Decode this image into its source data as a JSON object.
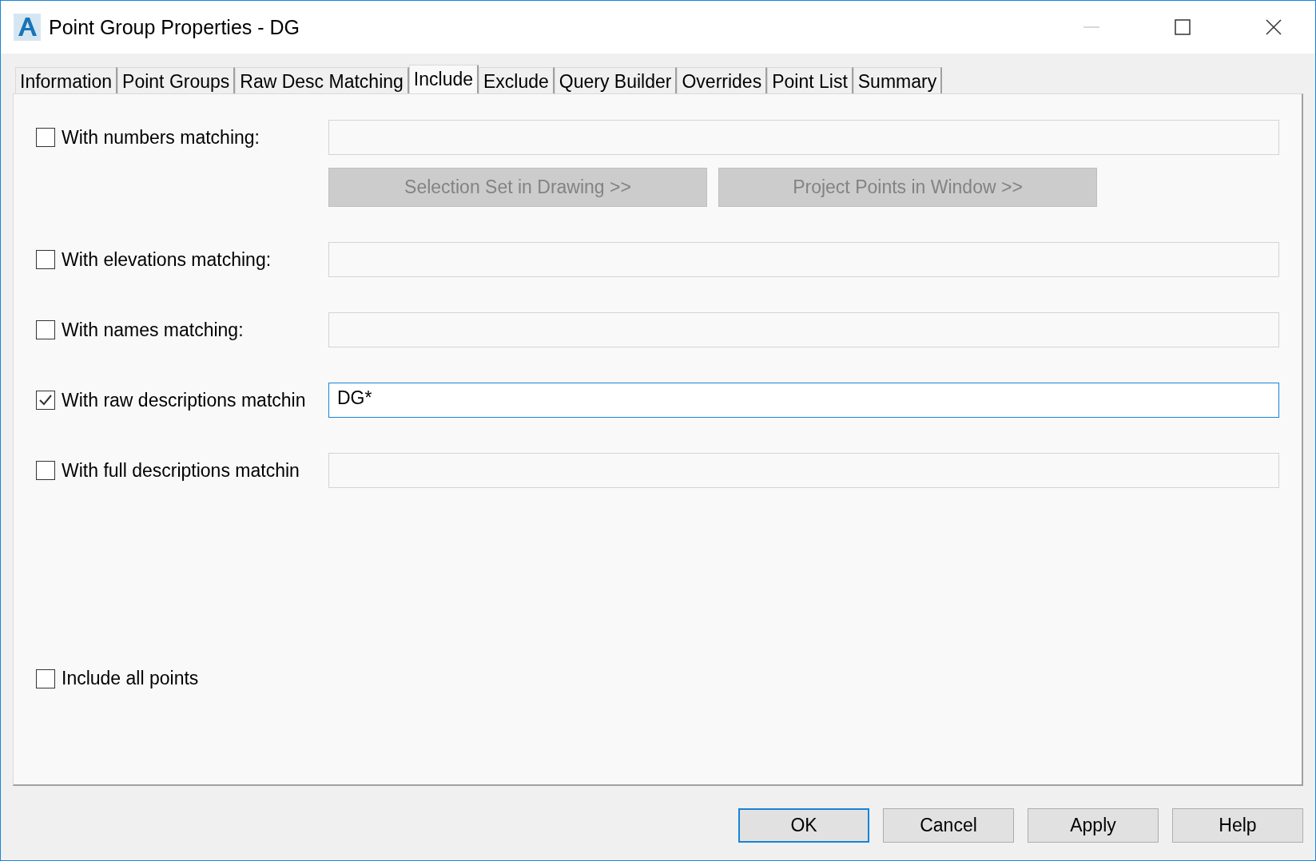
{
  "window": {
    "title": "Point Group Properties - DG"
  },
  "tabs": [
    {
      "label": "Information",
      "selected": false
    },
    {
      "label": "Point Groups",
      "selected": false
    },
    {
      "label": "Raw Desc Matching",
      "selected": false
    },
    {
      "label": "Include",
      "selected": true
    },
    {
      "label": "Exclude",
      "selected": false
    },
    {
      "label": "Query Builder",
      "selected": false
    },
    {
      "label": "Overrides",
      "selected": false
    },
    {
      "label": "Point List",
      "selected": false
    },
    {
      "label": "Summary",
      "selected": false
    }
  ],
  "criteria": [
    {
      "label": "With numbers matching:",
      "checked": false,
      "focused": false,
      "actions": [
        {
          "label": "Selection Set in Drawing >>",
          "disabled": true
        },
        {
          "label": "Project Points in Window >>",
          "disabled": true
        }
      ]
    },
    {
      "label": "With elevations matching:",
      "checked": false,
      "focused": false
    },
    {
      "label": "With names matching:",
      "checked": false,
      "focused": false
    },
    {
      "label": "With raw descriptions matchin",
      "checked": true,
      "value": "DG*",
      "focused": true
    },
    {
      "label": "With full descriptions matchin",
      "checked": false,
      "focused": false
    }
  ],
  "include_all": {
    "label": "Include all points",
    "checked": false
  },
  "dialog_buttons": [
    {
      "label": "OK",
      "default": true
    },
    {
      "label": "Cancel",
      "default": false
    },
    {
      "label": "Apply",
      "default": false
    },
    {
      "label": "Help",
      "default": false
    }
  ]
}
